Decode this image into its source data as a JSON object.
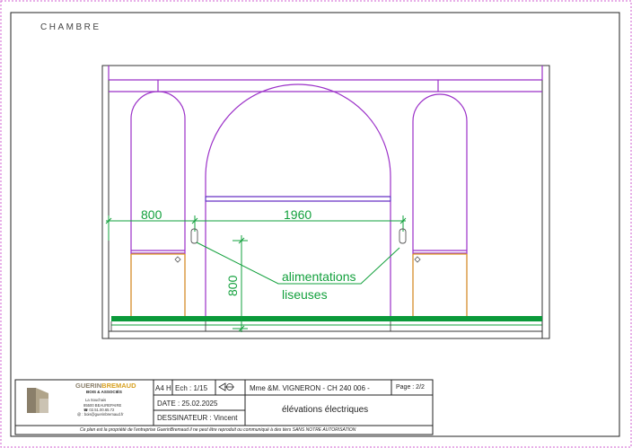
{
  "sheet": {
    "room_label": "CHAMBRE"
  },
  "dimensions": {
    "left_width": "800",
    "center_width": "1960",
    "height": "800"
  },
  "annotation": {
    "line1": "alimentations",
    "line2": "liseuses"
  },
  "colors": {
    "walls": "#9b30c8",
    "cabinets": "#e0a020",
    "dimensions": "#12a03c",
    "plinth": "#0a9a3a",
    "logo": "#8a7f6a"
  },
  "title_block": {
    "company_name_a": "GUERIN",
    "company_name_b": "BREMAUD",
    "company_sub": "BOIS & ASSOCIÉS",
    "company_lines": [
      "La Souchais",
      "85500 BEAUREPAIRE",
      "☎ 02.51.00.65.72",
      "@ : bois@guerinbremaud.fr"
    ],
    "format": "A4 H",
    "scale": "Ech : 1/15",
    "date": "DATE : 25.02.2025",
    "designer": "DESSINATEUR : Vincent",
    "client": "Mme &M. VIGNERON - CH 240 006 -",
    "page": "Page : 2/2",
    "subject": "élévations électriques",
    "disclaimer": "Ce plan est la propriété de l'entreprise GuerinBremaud il ne peut être reproduit ou communiqué à des tiers SANS NOTRE AUTORISATION"
  }
}
